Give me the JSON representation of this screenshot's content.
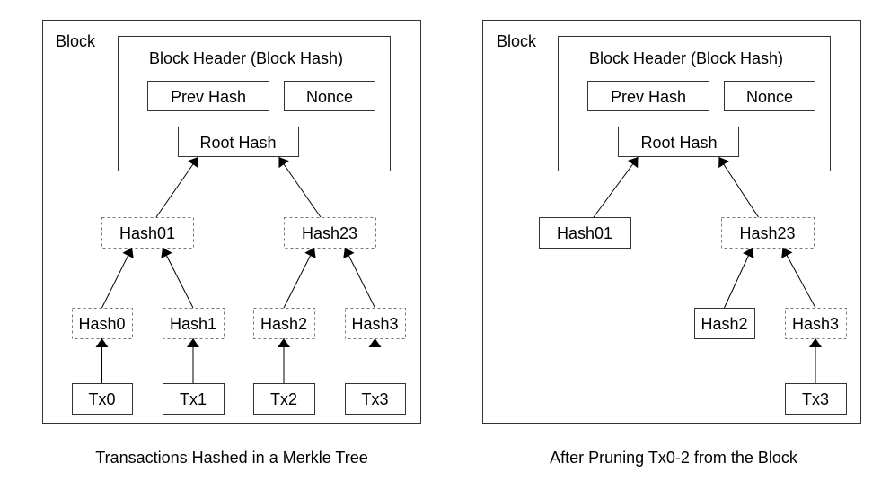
{
  "panels": [
    {
      "id": "full",
      "block_label": "Block",
      "header_label": "Block Header (Block Hash)",
      "prev_hash": "Prev Hash",
      "nonce": "Nonce",
      "root_hash": "Root Hash",
      "caption": "Transactions Hashed in a Merkle Tree",
      "nodes": [
        {
          "id": "hash01",
          "label": "Hash01",
          "style": "dashed"
        },
        {
          "id": "hash23",
          "label": "Hash23",
          "style": "dashed"
        },
        {
          "id": "hash0",
          "label": "Hash0",
          "style": "dashed"
        },
        {
          "id": "hash1",
          "label": "Hash1",
          "style": "dashed"
        },
        {
          "id": "hash2",
          "label": "Hash2",
          "style": "dashed"
        },
        {
          "id": "hash3",
          "label": "Hash3",
          "style": "dashed"
        },
        {
          "id": "tx0",
          "label": "Tx0",
          "style": "solid"
        },
        {
          "id": "tx1",
          "label": "Tx1",
          "style": "solid"
        },
        {
          "id": "tx2",
          "label": "Tx2",
          "style": "solid"
        },
        {
          "id": "tx3",
          "label": "Tx3",
          "style": "solid"
        }
      ],
      "edges": [
        [
          "hash01",
          "root"
        ],
        [
          "hash23",
          "root"
        ],
        [
          "hash0",
          "hash01"
        ],
        [
          "hash1",
          "hash01"
        ],
        [
          "hash2",
          "hash23"
        ],
        [
          "hash3",
          "hash23"
        ],
        [
          "tx0",
          "hash0"
        ],
        [
          "tx1",
          "hash1"
        ],
        [
          "tx2",
          "hash2"
        ],
        [
          "tx3",
          "hash3"
        ]
      ]
    },
    {
      "id": "pruned",
      "block_label": "Block",
      "header_label": "Block Header (Block Hash)",
      "prev_hash": "Prev Hash",
      "nonce": "Nonce",
      "root_hash": "Root Hash",
      "caption": "After Pruning Tx0-2 from the Block",
      "nodes": [
        {
          "id": "hash01",
          "label": "Hash01",
          "style": "solid"
        },
        {
          "id": "hash23",
          "label": "Hash23",
          "style": "dashed"
        },
        {
          "id": "hash2",
          "label": "Hash2",
          "style": "solid"
        },
        {
          "id": "hash3",
          "label": "Hash3",
          "style": "dashed"
        },
        {
          "id": "tx3",
          "label": "Tx3",
          "style": "solid"
        }
      ],
      "edges": [
        [
          "hash01",
          "root"
        ],
        [
          "hash23",
          "root"
        ],
        [
          "hash2",
          "hash23"
        ],
        [
          "hash3",
          "hash23"
        ],
        [
          "tx3",
          "hash3"
        ]
      ]
    }
  ]
}
